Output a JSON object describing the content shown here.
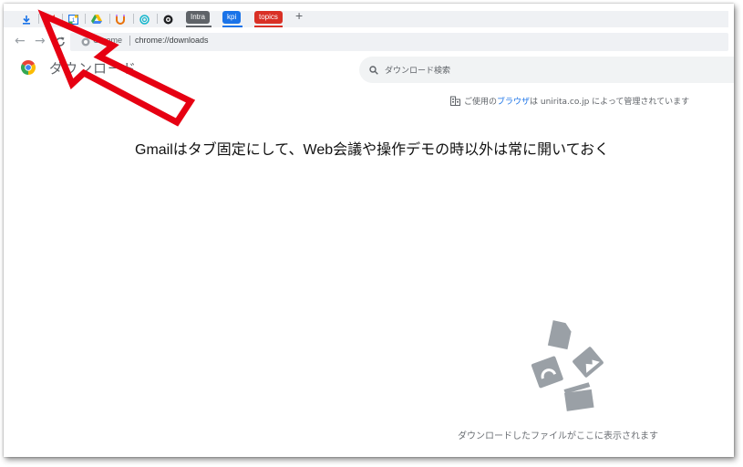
{
  "tabs": {
    "pinned": [
      {
        "name": "download-icon"
      },
      {
        "name": "gmail-icon"
      },
      {
        "name": "calendar-icon"
      },
      {
        "name": "drive-icon"
      },
      {
        "name": "magnet-icon"
      },
      {
        "name": "swirl-icon"
      },
      {
        "name": "app-icon"
      }
    ],
    "groups": [
      {
        "label": "Intra",
        "color": "#5f6368"
      },
      {
        "label": "kpi",
        "color": "#1a73e8"
      },
      {
        "label": "topics",
        "color": "#d93025"
      }
    ],
    "new_tab": "+"
  },
  "toolbar": {
    "back": "←",
    "forward": "→",
    "site_label": "Chrome",
    "url": "chrome://downloads"
  },
  "page": {
    "title": "ダウンロード",
    "search_placeholder": "ダウンロード検索",
    "managed_prefix": "ご使用の",
    "managed_link": "ブラウザ",
    "managed_suffix": "は unirita.co.jp によって管理されています",
    "empty_message": "ダウンロードしたファイルがここに表示されます"
  },
  "annotation": {
    "note": "Gmailはタブ固定にして、Web会議や操作デモの時以外は常に開いておく",
    "arrow_color": "#e60012"
  }
}
